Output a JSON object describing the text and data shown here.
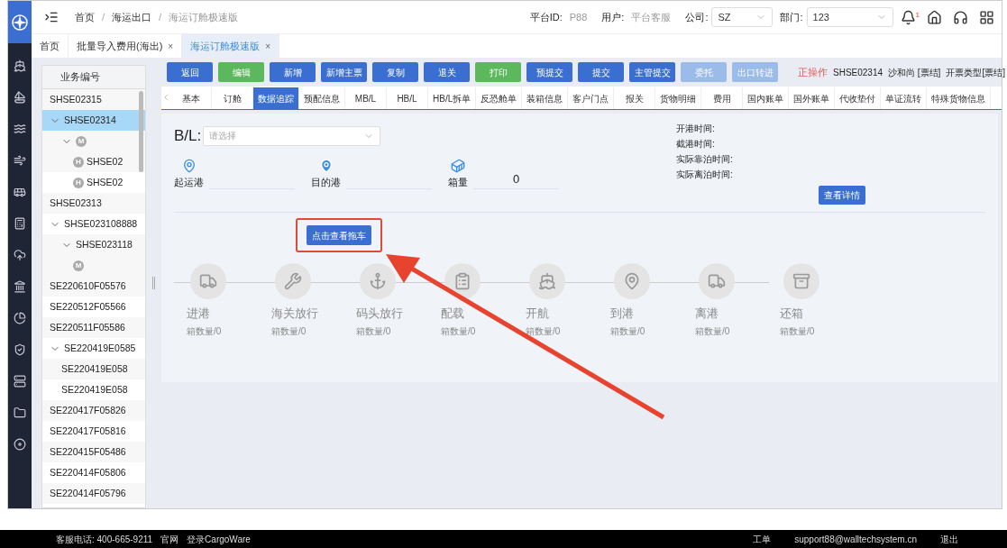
{
  "header": {
    "breadcrumbs": [
      {
        "label": "首页",
        "current": false
      },
      {
        "label": "海运出口",
        "current": false
      },
      {
        "label": "海运订舱极速版",
        "current": true
      }
    ],
    "fields": [
      {
        "label": "平台ID:",
        "value": "P88"
      },
      {
        "label": "用户:",
        "value": "平台客服"
      }
    ],
    "selects": [
      {
        "label": "公司:",
        "value": "SZ"
      },
      {
        "label": "部门:",
        "value": "123"
      }
    ],
    "notification_count": "1",
    "separator": "/"
  },
  "page_tabs": [
    {
      "label": "首页",
      "selected": false,
      "closable": false
    },
    {
      "label": "批量导入费用(海出)",
      "selected": false,
      "closable": true
    },
    {
      "label": "海运订舱极速版",
      "selected": true,
      "closable": true
    }
  ],
  "close_glyph": "×",
  "tree": {
    "header": "业务编号",
    "items": [
      {
        "label": "SHSE02315",
        "selected": false
      },
      {
        "label": "SHSE02314",
        "selected": true,
        "expanded": true,
        "children": [
          {
            "badge": "M",
            "selected": false,
            "expanded": true,
            "children": [
              {
                "badge": "H",
                "label": "SHSE02",
                "selected": false
              },
              {
                "badge": "H",
                "label": "SHSE02",
                "selected": false
              }
            ]
          }
        ]
      },
      {
        "label": "SHSE02313",
        "selected": false
      },
      {
        "label": "SHSE023108888",
        "selected": false,
        "expanded": true,
        "children": [
          {
            "label": "SHSE023118",
            "selected": false,
            "expanded": true,
            "children": [
              {
                "badge": "M",
                "selected": false
              }
            ]
          }
        ]
      },
      {
        "label": "SE220610F05576",
        "selected": false
      },
      {
        "label": "SE220512F05566",
        "selected": false
      },
      {
        "label": "SE220511F05586",
        "selected": false
      },
      {
        "label": "SE220419E0585",
        "selected": false,
        "expanded": true,
        "children": [
          {
            "label": "SE220419E058",
            "selected": false
          },
          {
            "label": "SE220419E058",
            "selected": false
          }
        ]
      },
      {
        "label": "SE220417F05826",
        "selected": false
      },
      {
        "label": "SE220417F05816",
        "selected": false
      },
      {
        "label": "SE220415F05486",
        "selected": false
      },
      {
        "label": "SE220414F05806",
        "selected": false
      },
      {
        "label": "SE220414F05796",
        "selected": false
      }
    ]
  },
  "toolbar": {
    "buttons": [
      {
        "label": "返回",
        "kind": "primary",
        "disabled": false
      },
      {
        "label": "编辑",
        "kind": "success",
        "disabled": false
      },
      {
        "label": "新增",
        "kind": "primary",
        "disabled": false
      },
      {
        "label": "新增主票",
        "kind": "primary",
        "disabled": false
      },
      {
        "label": "复制",
        "kind": "primary",
        "disabled": false
      },
      {
        "label": "退关",
        "kind": "primary",
        "disabled": false
      },
      {
        "label": "打印",
        "kind": "success",
        "disabled": false
      },
      {
        "label": "预提交",
        "kind": "primary",
        "disabled": false
      },
      {
        "label": "提交",
        "kind": "primary",
        "disabled": false
      },
      {
        "label": "主管提交",
        "kind": "primary",
        "disabled": false
      },
      {
        "label": "委托",
        "kind": "primary",
        "disabled": true
      },
      {
        "label": "出口转进",
        "kind": "primary",
        "disabled": true
      }
    ],
    "status": "正操作",
    "info": [
      "SHSE02314",
      "沙和尚 [票结]",
      "开票类型[票结]"
    ]
  },
  "detail_tabs": [
    {
      "label": "基本",
      "selected": false
    },
    {
      "label": "订舱",
      "selected": false
    },
    {
      "label": "数据追踪",
      "selected": true
    },
    {
      "label": "预配信息",
      "selected": false
    },
    {
      "label": "MB/L",
      "selected": false
    },
    {
      "label": "HB/L",
      "selected": false
    },
    {
      "label": "HB/L拆单",
      "selected": false
    },
    {
      "label": "反恐舱单",
      "selected": false
    },
    {
      "label": "装箱信息",
      "selected": false
    },
    {
      "label": "客户门点",
      "selected": false
    },
    {
      "label": "报关",
      "selected": false
    },
    {
      "label": "货物明细",
      "selected": false
    },
    {
      "label": "费用",
      "selected": false
    },
    {
      "label": "国内账单",
      "selected": false
    },
    {
      "label": "国外账单",
      "selected": false
    },
    {
      "label": "代收垫付",
      "selected": false
    },
    {
      "label": "单证流转",
      "selected": false
    },
    {
      "label": "特殊货物信息",
      "selected": false
    }
  ],
  "tracking": {
    "bl_label": "B/L:",
    "bl_placeholder": "请选择",
    "ports": [
      {
        "kind": "origin",
        "label": "起运港"
      },
      {
        "kind": "destination",
        "label": "目的港"
      },
      {
        "kind": "containers",
        "label": "箱量",
        "value": "0"
      }
    ],
    "times": [
      "开港时间:",
      "截港时间:",
      "实际靠泊时间:",
      "实际离泊时间:"
    ],
    "detail_button": "查看详情",
    "truck_button": "点击查看拖车",
    "steps": [
      {
        "kind": "truck",
        "label": "进港",
        "count": "箱数量/0",
        "done": false
      },
      {
        "kind": "customs",
        "label": "海关放行",
        "count": "箱数量/0",
        "done": false
      },
      {
        "kind": "anchor",
        "label": "码头放行",
        "count": "箱数量/0",
        "done": false
      },
      {
        "kind": "stow",
        "label": "配载",
        "count": "箱数量/0",
        "done": false
      },
      {
        "kind": "ship",
        "label": "开航",
        "count": "箱数量/0",
        "done": false
      },
      {
        "kind": "arrive",
        "label": "到港",
        "count": "箱数量/0",
        "done": false
      },
      {
        "kind": "truck",
        "label": "离港",
        "count": "箱数量/0",
        "done": false
      },
      {
        "kind": "box",
        "label": "还箱",
        "count": "箱数量/0",
        "done": false
      }
    ]
  },
  "footer": {
    "left": [
      "客服电话: 400-665-9211",
      "官网",
      "登录CargoWare"
    ],
    "right": [
      "工单",
      "support88@walltechsystem.cn",
      "退出"
    ]
  }
}
